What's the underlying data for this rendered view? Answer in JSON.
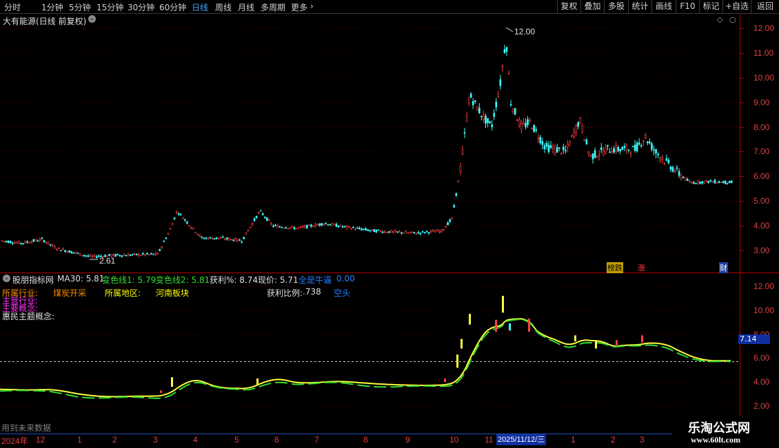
{
  "toolbar": {
    "periods": [
      "分时",
      "1分钟",
      "5分钟",
      "15分钟",
      "30分钟",
      "60分钟",
      "日线",
      "周线",
      "月线",
      "多周期",
      "更多"
    ],
    "active_period": "日线",
    "right_buttons": [
      "复权",
      "叠加",
      "多股",
      "统计",
      "画线",
      "F10",
      "标记",
      "+自选",
      "返回"
    ]
  },
  "main_chart": {
    "title": "大有能源(日线 前复权)",
    "y_ticks": [
      "12.00",
      "11.00",
      "10.00",
      "9.00",
      "8.00",
      "7.00",
      "6.00",
      "5.00",
      "4.00",
      "3.00"
    ],
    "high_label": "12.00",
    "low_label": "2.61",
    "badges": {
      "bangdie": "榜跌",
      "zhang": "涨",
      "cai": "财"
    }
  },
  "indicator": {
    "name": "股朋指标网",
    "ma30_label": "MA30: 5.81",
    "line1_label": "变色线1: 5.79",
    "line2_label": "变色线2: 5.81",
    "profit_pct_label": "获利%: 8.74",
    "price_label": "现价: 5.71",
    "signal_label": "全是牛逼",
    "signal_value": "0.00",
    "industry_label": "所属行业:",
    "industry_value": "煤炭开采",
    "region_label": "所属地区:",
    "region_value": "河南板块",
    "ratio_label": "获利比例:",
    "ratio_value": ".738",
    "trend_value": "空头",
    "line3_label": "主营行业:",
    "line4_label": "主要概念:",
    "line5_label": "惠民主题概念:",
    "y_ticks": [
      "12.00",
      "10.00",
      "8.00",
      "6.00",
      "4.00",
      "2.00"
    ],
    "current_value": "7.14",
    "footnote": "用到未来数据"
  },
  "time_axis": {
    "year": "2024年",
    "months": [
      "12",
      "1",
      "2",
      "3",
      "4",
      "5",
      "6",
      "7",
      "8",
      "9",
      "10",
      "11"
    ],
    "cursor_date": "2025/11/12/三",
    "months_after": [
      "1",
      "2",
      "3"
    ]
  },
  "watermark": {
    "line1": "乐淘公式网",
    "line2": "www.60lt.com"
  },
  "colors": {
    "up": "#ff4040",
    "down": "#40ffff",
    "ma": "#ffff00",
    "green": "#30e030",
    "axis": "#e04040"
  }
}
